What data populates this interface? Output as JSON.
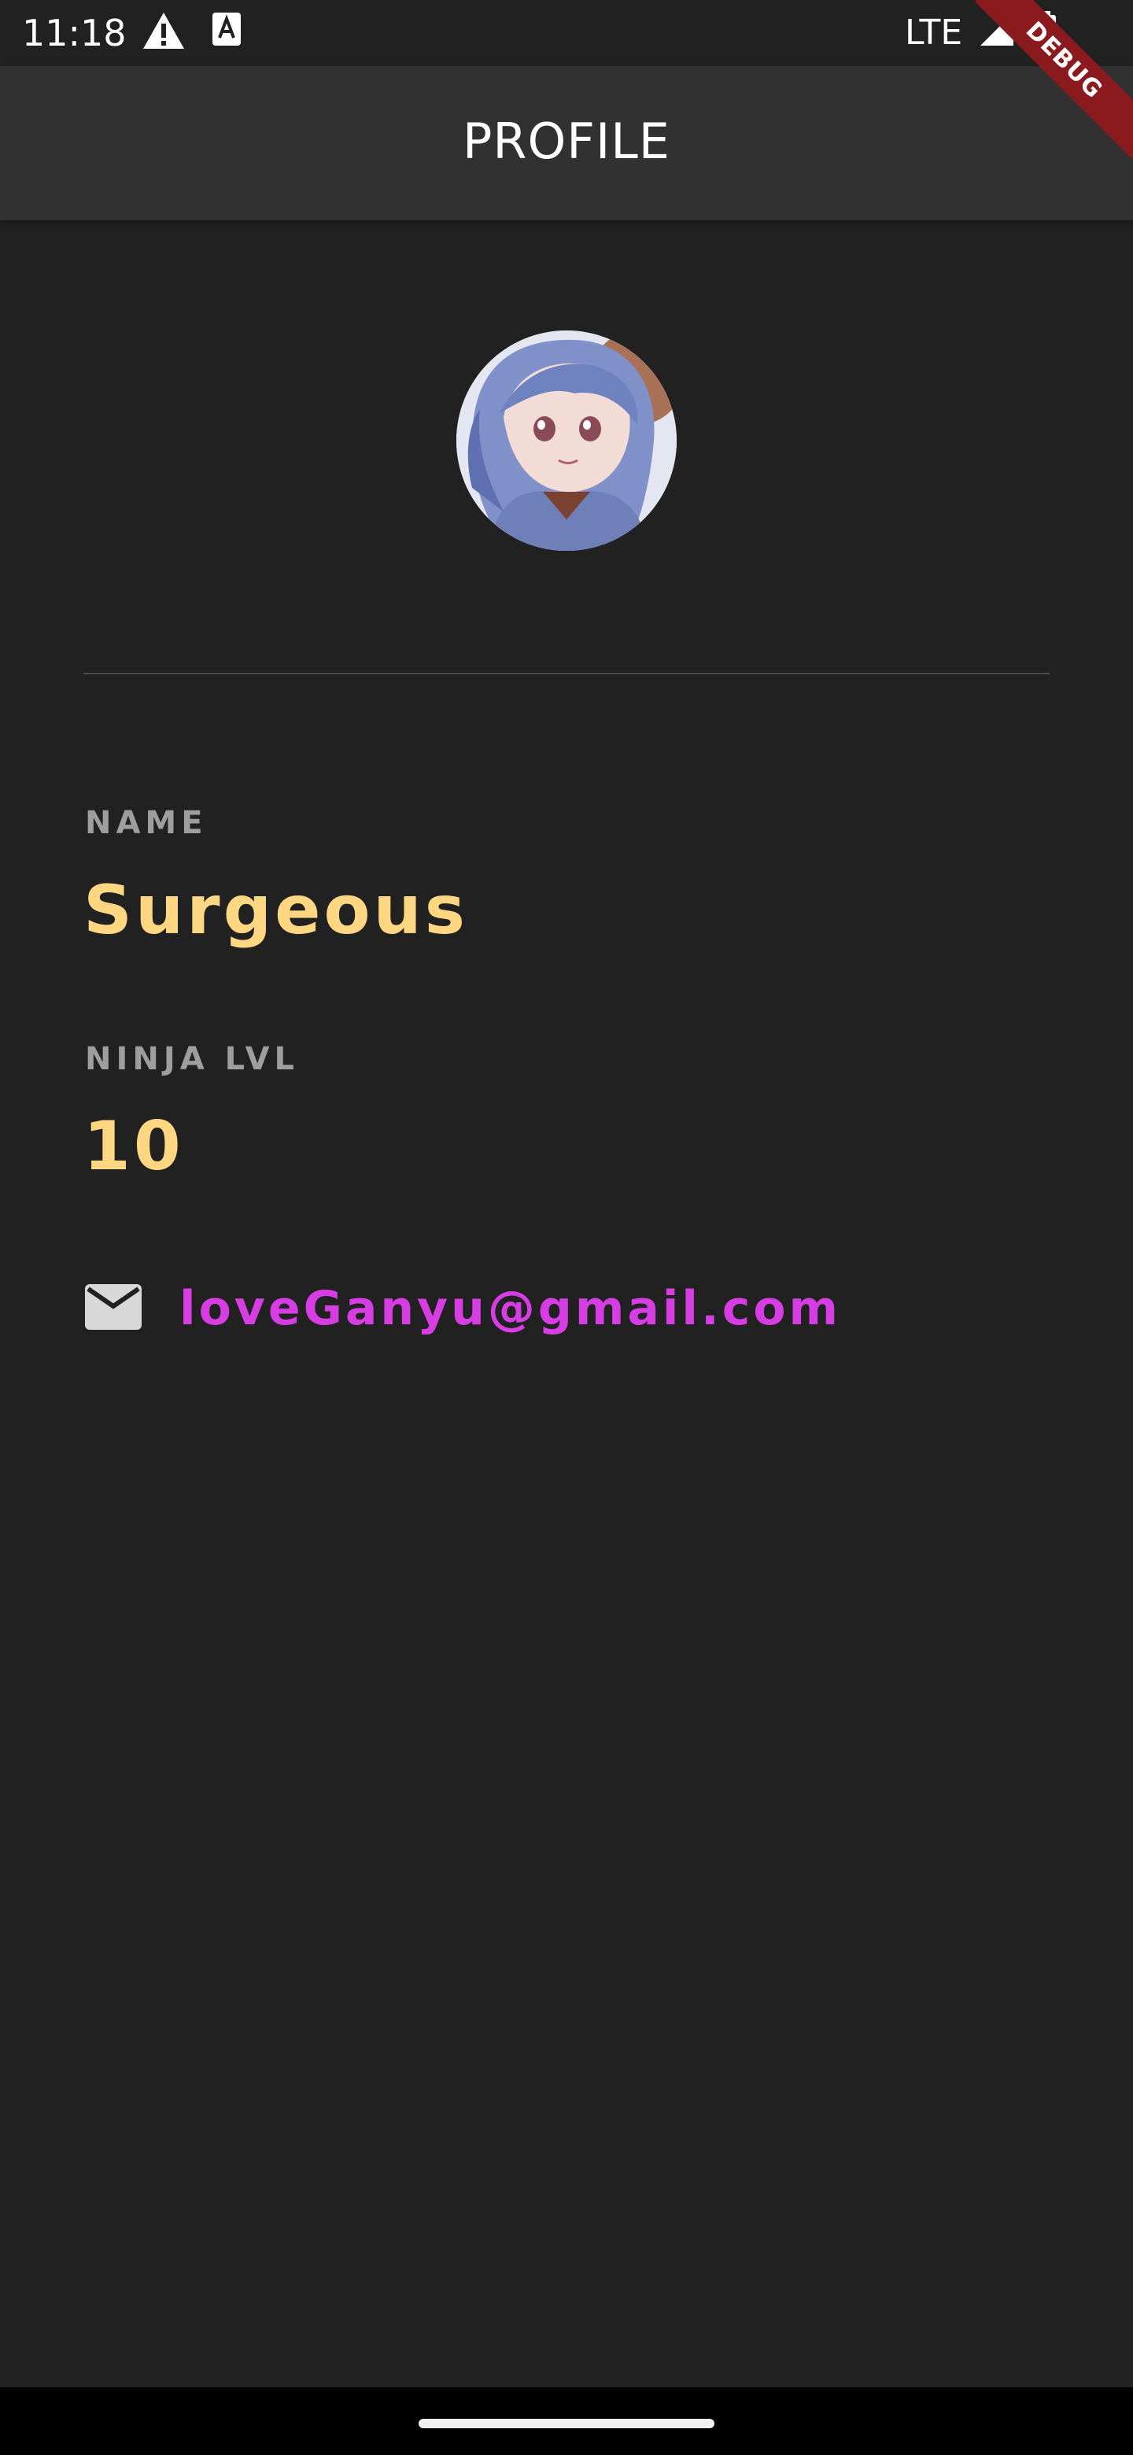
{
  "status_bar": {
    "time": "11:18",
    "network": "LTE",
    "icons": [
      "warning-icon",
      "text-a-icon",
      "signal-icon",
      "battery-icon"
    ]
  },
  "debug_banner": {
    "label": "DEBUG"
  },
  "app_bar": {
    "title": "PROFILE"
  },
  "profile": {
    "name_label": "NAME",
    "name_value": "Surgeous",
    "level_label": "NINJA LVL",
    "level_value": "10",
    "email": "loveGanyu@gmail.com",
    "email_icon": "mail-icon"
  },
  "colors": {
    "background": "#212121",
    "app_bar": "#313131",
    "label": "#9e9e9e",
    "value": "#ffd782",
    "email": "#d63ee4",
    "debug": "#8b1a1f"
  }
}
